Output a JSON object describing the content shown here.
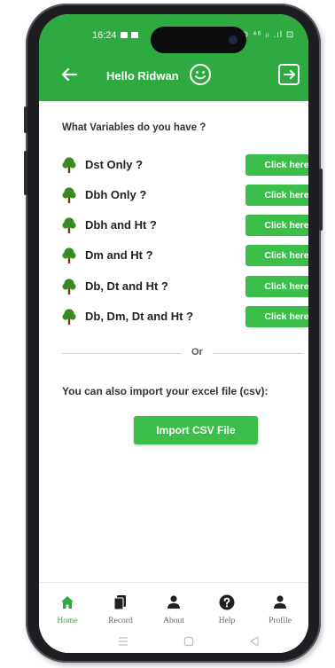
{
  "status_bar": {
    "time": "16:24",
    "right_icons": "⊙ ⁴⁶ ᵢₗ .ıl ⊡"
  },
  "header": {
    "greeting": "Hello Ridwan"
  },
  "main": {
    "question": "What Variables do you have ?",
    "variables": [
      {
        "label": "Dst Only ?",
        "button": "Click here"
      },
      {
        "label": "Dbh Only ?",
        "button": "Click here"
      },
      {
        "label": "Dbh and Ht ?",
        "button": "Click here"
      },
      {
        "label": "Dm and Ht ?",
        "button": "Click here"
      },
      {
        "label": "Db, Dt and Ht ?",
        "button": "Click here"
      },
      {
        "label": "Db, Dm, Dt and Ht ?",
        "button": "Click here"
      }
    ],
    "or_text": "Or",
    "import_text": "You can also import your excel file (csv):",
    "import_button": "Import CSV File"
  },
  "bottom_nav": {
    "items": [
      {
        "label": "Home",
        "icon": "home-icon",
        "active": true
      },
      {
        "label": "Record",
        "icon": "record-icon",
        "active": false
      },
      {
        "label": "About",
        "icon": "person-icon",
        "active": false
      },
      {
        "label": "Help",
        "icon": "help-icon",
        "active": false
      },
      {
        "label": "Profile",
        "icon": "person-icon",
        "active": false
      }
    ]
  },
  "colors": {
    "primary": "#2eaa41",
    "button": "#3bbf4a",
    "tree_leaf": "#3a8a22",
    "tree_trunk": "#6b3f1d"
  }
}
